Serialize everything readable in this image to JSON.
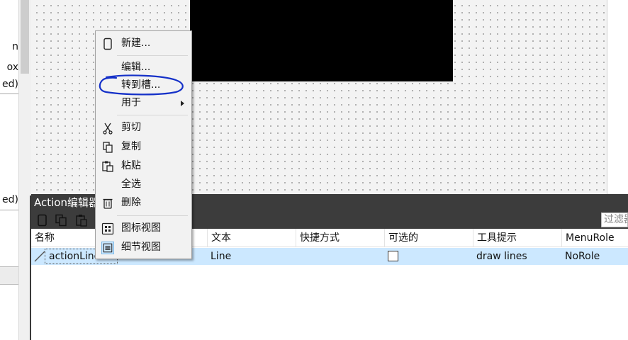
{
  "left_panel": {
    "fragments": [
      "n",
      "ox",
      "ed)",
      "ed)"
    ]
  },
  "context_menu": {
    "items": [
      {
        "label": "新建...",
        "icon": "new-document-icon"
      },
      {
        "label": "编辑...",
        "icon": ""
      },
      {
        "label": "转到槽...",
        "icon": ""
      },
      {
        "label": "用于",
        "icon": "",
        "submenu": true
      },
      {
        "label": "剪切",
        "icon": "cut-icon"
      },
      {
        "label": "复制",
        "icon": "copy-icon"
      },
      {
        "label": "粘贴",
        "icon": "paste-icon"
      },
      {
        "label": "全选",
        "icon": ""
      },
      {
        "label": "删除",
        "icon": "trash-icon"
      },
      {
        "label": "图标视图",
        "icon": "icon-view-icon"
      },
      {
        "label": "细节视图",
        "icon": "detail-view-icon",
        "checked": true
      }
    ]
  },
  "action_editor": {
    "title": "Action编辑器",
    "filter_placeholder": "过滤器",
    "columns": [
      "名称",
      "文本",
      "快捷方式",
      "可选的",
      "工具提示",
      "MenuRole"
    ],
    "rows": [
      {
        "name": "actionLine",
        "text": "Line",
        "shortcut": "",
        "checkable": false,
        "tooltip": "draw lines",
        "menu_role": "NoRole"
      }
    ]
  },
  "colors": {
    "selection": "#cce8ff",
    "dock_title_bg": "#3c3c3c",
    "annotation_stroke": "#1430c8"
  }
}
